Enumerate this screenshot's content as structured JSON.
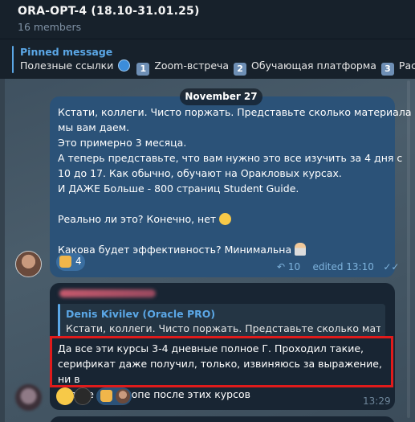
{
  "header": {
    "title": "ORA-OPT-4 (18.10-31.01.25)",
    "subtitle": "16 members"
  },
  "pinned": {
    "label": "Pinned message",
    "text_1": "Полезные ссылки",
    "key_1": "1",
    "text_2": "Zoom-встреча",
    "key_2": "2",
    "text_3": "Обучающая платформа",
    "key_3": "3",
    "text_4": "Распи"
  },
  "date_separator": "November 27",
  "message1": {
    "lines": [
      "Кстати, коллеги. Чисто поржать. Представьте сколько материала",
      "мы вам даем.",
      "Это примерно 3 месяца.",
      "А теперь представьте, что вам нужно это все изучить за 4 дня с",
      "10 до 17. Как обычно, обучают на Оракловых курсах.",
      "И ДАЖЕ Больше - 800 страниц Student Guide.",
      "",
      "Реально ли это? Конечно, нет",
      "",
      "Какова будет эффективность? Минимальна"
    ],
    "reaction_count": "4",
    "replies_count": "10",
    "edited_time": "edited 13:10"
  },
  "message2": {
    "reply_author": "Denis Kivilev (Oracle PRO)",
    "reply_text": "Кстати, коллеги. Чисто поржать. Представьте сколько матер...",
    "lines": [
      "Да все эти курсы 3-4 дневные полное Г. Проходил такие,",
      "серификат даже получил, только, извиняюсь за выражение, ни в",
      "голове ни в жопе после этих курсов"
    ],
    "time": "13:29"
  },
  "colors": {
    "accent": "#5ba7e6",
    "outgoing_bubble": "#2b5278",
    "incoming_bubble": "#182533",
    "highlight": "#e01b1b"
  }
}
